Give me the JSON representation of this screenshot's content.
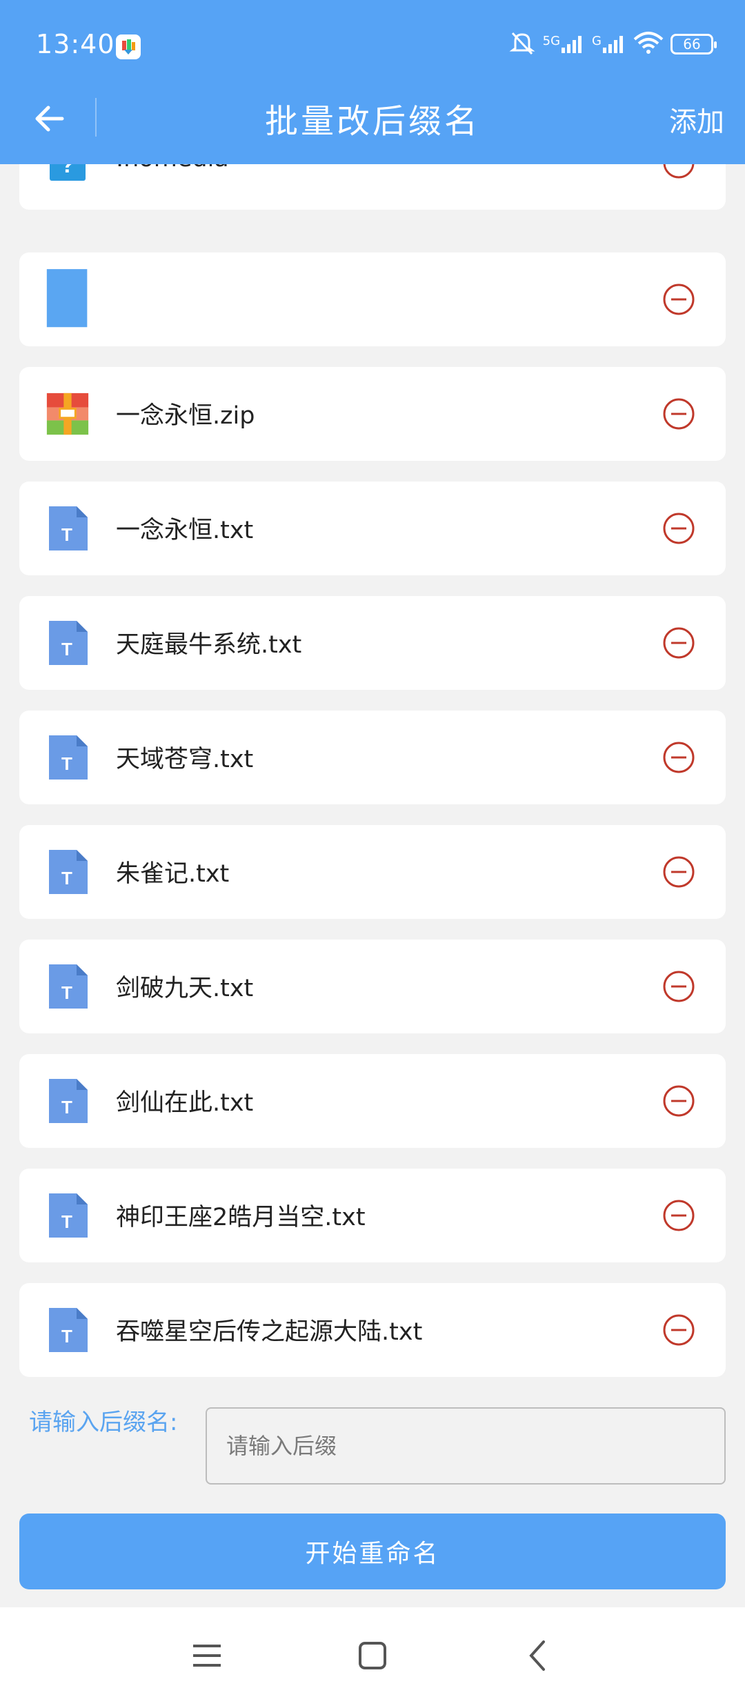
{
  "status": {
    "time": "13:40",
    "battery": "66",
    "net1": "5G",
    "net2": "G"
  },
  "header": {
    "title": "批量改后缀名",
    "add_label": "添加"
  },
  "files": [
    {
      "name": ".nomedia",
      "type": "unknown"
    },
    {
      "name": "",
      "type": "folder"
    },
    {
      "name": "一念永恒.zip",
      "type": "zip"
    },
    {
      "name": "一念永恒.txt",
      "type": "txt"
    },
    {
      "name": "天庭最牛系统.txt",
      "type": "txt"
    },
    {
      "name": "天域苍穹.txt",
      "type": "txt"
    },
    {
      "name": "朱雀记.txt",
      "type": "txt"
    },
    {
      "name": "剑破九天.txt",
      "type": "txt"
    },
    {
      "name": "剑仙在此.txt",
      "type": "txt"
    },
    {
      "name": "神印王座2皓月当空.txt",
      "type": "txt"
    },
    {
      "name": "吞噬星空后传之起源大陆.txt",
      "type": "txt"
    }
  ],
  "suffix": {
    "label": "请输入后缀名:",
    "placeholder": "请输入后缀",
    "value": ""
  },
  "actions": {
    "start_label": "开始重命名"
  },
  "colors": {
    "accent": "#56a3f5",
    "remove": "#c0392b",
    "txt_icon": "#6a9be6"
  }
}
